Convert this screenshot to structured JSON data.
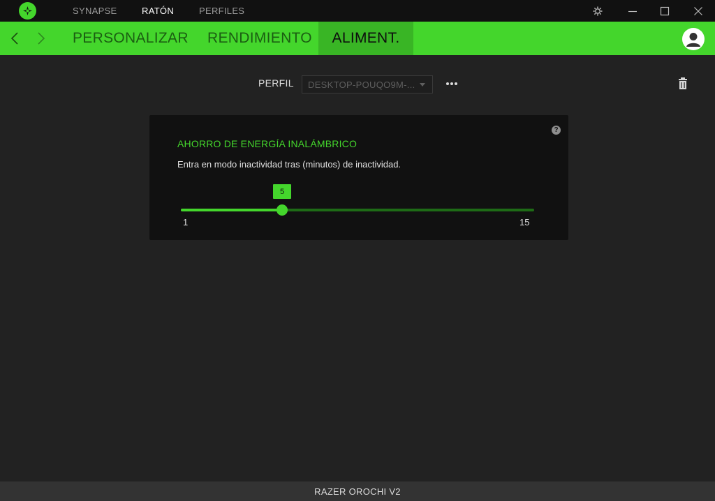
{
  "titlebar": {
    "nav": [
      "SYNAPSE",
      "RATÓN",
      "PERFILES"
    ],
    "active_nav": "RATÓN",
    "icons": [
      "razer-logo-icon",
      "gear-icon",
      "minimize-icon",
      "maximize-icon",
      "close-icon"
    ]
  },
  "tabbar": {
    "tabs": [
      "PERSONALIZAR",
      "RENDIMIENTO",
      "ALIMENT."
    ],
    "active_tab": "ALIMENT."
  },
  "profile": {
    "label": "PERFIL",
    "selected": "DESKTOP-POUQO9M-..."
  },
  "power_card": {
    "title": "AHORRO DE ENERGÍA INALÁMBRICO",
    "description": "Entra en modo inactividad tras (minutos) de inactividad.",
    "help_glyph": "?",
    "slider": {
      "min": 1,
      "max": 15,
      "value": 5,
      "min_label": "1",
      "max_label": "15",
      "value_label": "5"
    }
  },
  "footer": {
    "device": "RAZER OROCHI V2"
  },
  "colors": {
    "accent": "#44d62c",
    "accent_dark": "#39b525",
    "background": "#222222",
    "card": "#111111"
  }
}
